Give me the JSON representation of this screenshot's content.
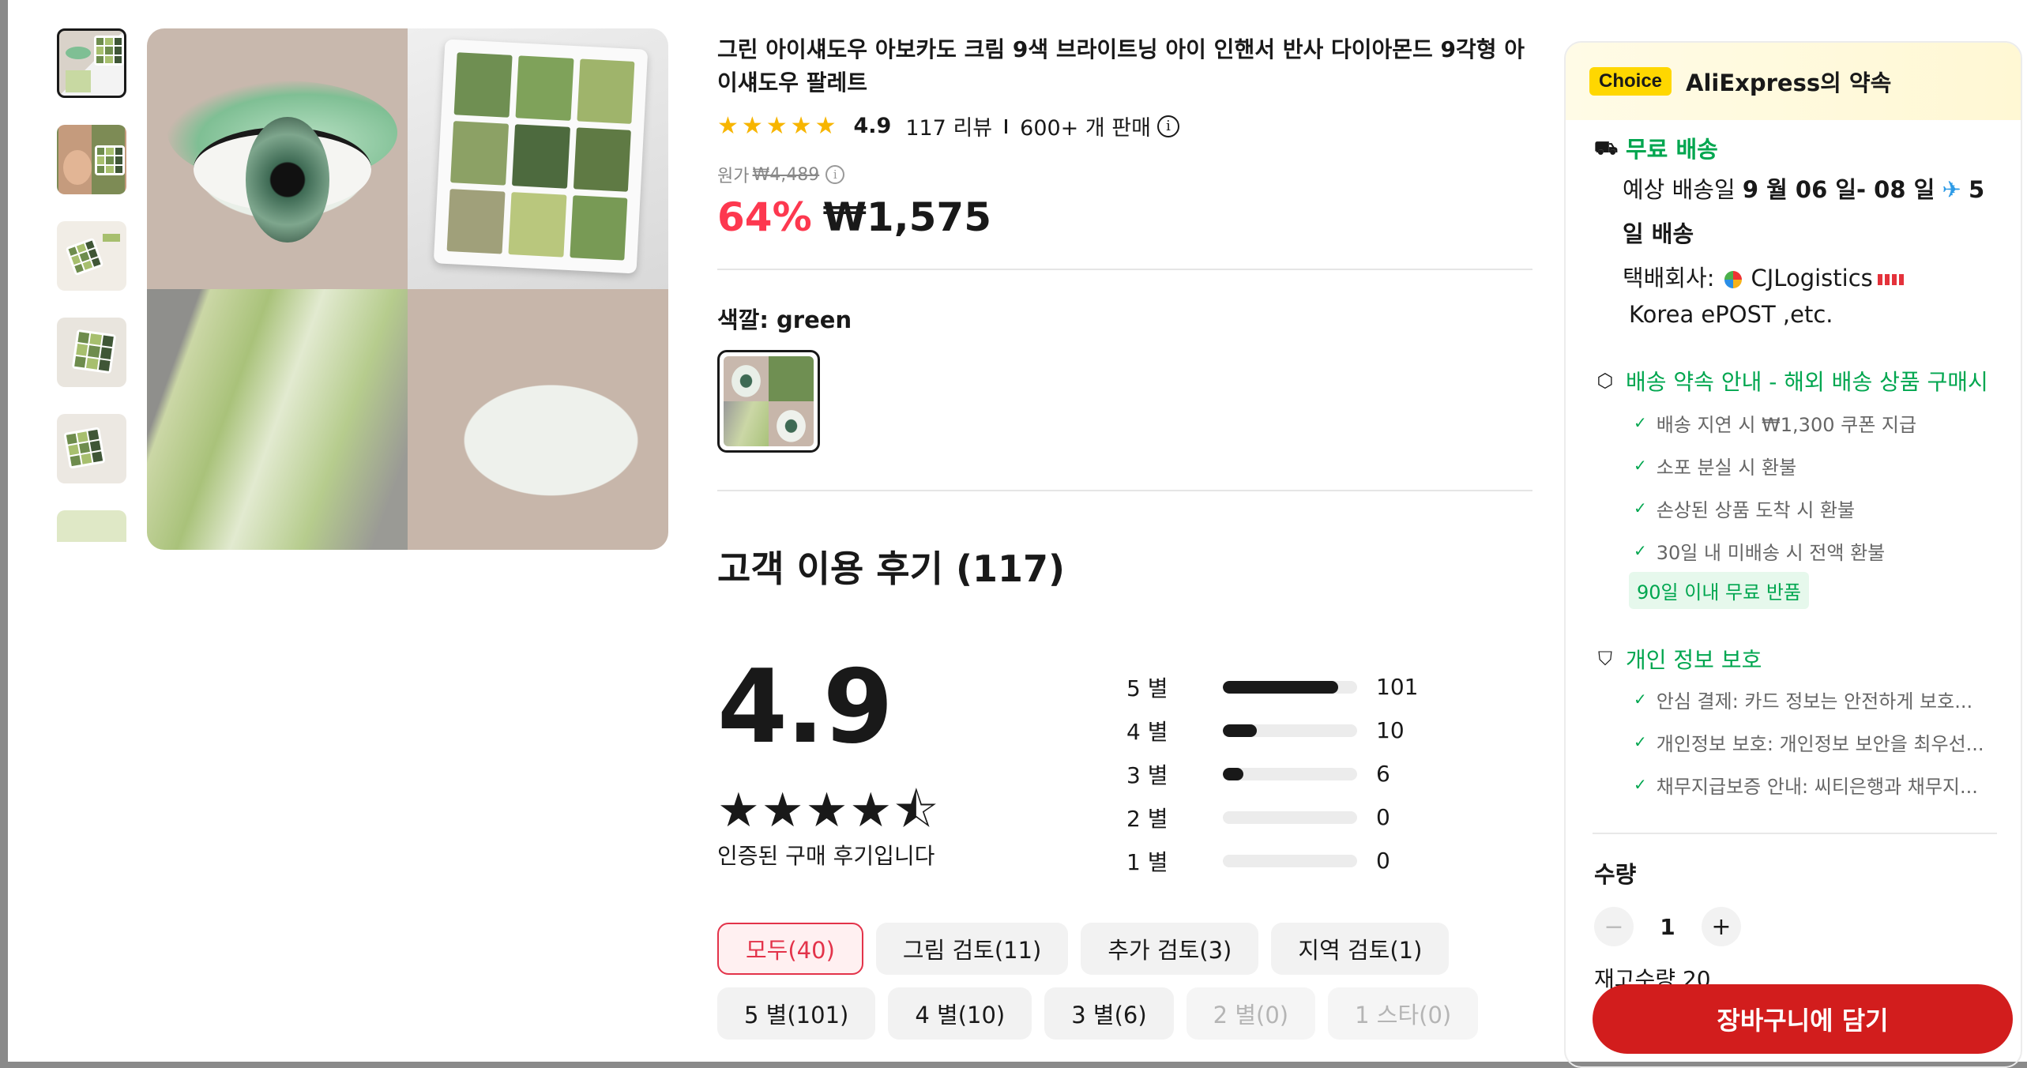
{
  "product": {
    "title": "그린 아이섀도우 아보카도 크림 9색 브라이트닝 아이 인핸서 반사 다이아몬드 9각형 아이섀도우 팔레트",
    "rating": "4.9",
    "reviews_count_text": "117 리뷰",
    "sold_text": "600+ 개 판매",
    "original_label": "원가",
    "original_price": "₩4,489",
    "discount": "64%",
    "price": "₩1,575",
    "color_label": "색깔: green"
  },
  "reviews": {
    "title": "고객 이용 후기 (117)",
    "score": "4.9",
    "stars_text": "★★★★⯪",
    "verified_text": "인증된 구매 후기입니다",
    "histogram": [
      {
        "label": "5 별",
        "count": "101",
        "fraction": 0.86
      },
      {
        "label": "4 별",
        "count": "10",
        "fraction": 0.25
      },
      {
        "label": "3 별",
        "count": "6",
        "fraction": 0.15
      },
      {
        "label": "2 별",
        "count": "0",
        "fraction": 0
      },
      {
        "label": "1 별",
        "count": "0",
        "fraction": 0
      }
    ],
    "filters_row1": [
      "모두(40)",
      "그림 검토(11)",
      "추가 검토(3)",
      "지역 검토(1)"
    ],
    "filters_row2": [
      "5 별(101)",
      "4 별(10)",
      "3 별(6)",
      "2 별(0)",
      "1 스타(0)"
    ]
  },
  "panel": {
    "choice_badge": "Choice",
    "choice_title": "AliExpress의 약속",
    "free_shipping": "무료 배송",
    "delivery_prefix": "예상 배송일",
    "delivery_date": "9 월 06 일- 08 일",
    "delivery_days": "5",
    "delivery_suffix": "일 배송",
    "carrier_label": "택배회사:",
    "carrier_name": "CJLogistics",
    "carrier_second": "Korea ePOST ,etc.",
    "promise_title": "배송 약속 안내 - 해외 배송 상품 구매시",
    "promise_items": [
      "배송 지연 시 ₩1,300 쿠폰 지급",
      "소포 분실 시 환불",
      "손상된 상품 도착 시 환불",
      "30일 내 미배송 시 전액 환불"
    ],
    "return_tag": "90일 이내 무료 반품",
    "privacy_title": "개인 정보 보호",
    "privacy_items": [
      "안심 결제: 카드 정보는 안전하게 보호...",
      "개인정보 보호: 개인정보 보안을 최우선...",
      "채무지급보증 안내: 씨티은행과 채무지..."
    ],
    "qty_label": "수량",
    "qty_value": "1",
    "minus": "−",
    "plus": "+",
    "stock_text": "재고수량 20",
    "cart_button": "장바구니에 담기"
  },
  "colors": {
    "accent_red": "#fd384f",
    "choice_yellow": "#ffd700",
    "green": "#00a64f",
    "cart_red": "#d21d1d"
  }
}
